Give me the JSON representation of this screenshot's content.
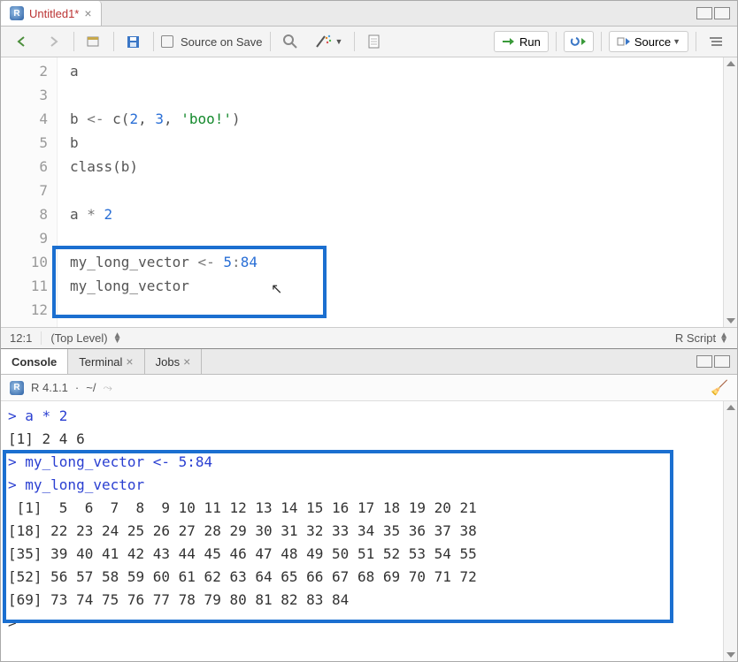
{
  "source": {
    "tab_title": "Untitled1*",
    "toolbar": {
      "source_on_save": "Source on Save",
      "run": "Run",
      "source_btn": "Source"
    },
    "gutter": [
      "2",
      "3",
      "4",
      "5",
      "6",
      "7",
      "8",
      "9",
      "10",
      "11",
      "12"
    ],
    "lines": {
      "l2": "a",
      "l3": "",
      "l4_pre": "b ",
      "l4_assign": "<-",
      "l4_c": " c(",
      "l4_n1": "2",
      "l4_c1": ", ",
      "l4_n2": "3",
      "l4_c2": ", ",
      "l4_str": "'boo!'",
      "l4_end": ")",
      "l5": "b",
      "l6": "class(b)",
      "l7": "",
      "l8_a": "a ",
      "l8_op": "*",
      "l8_sp": " ",
      "l8_n": "2",
      "l9": "",
      "l10_a": "my_long_vector ",
      "l10_assign": "<-",
      "l10_sp": " ",
      "l10_n1": "5",
      "l10_colon": ":",
      "l10_n2": "84",
      "l11": "my_long_vector",
      "l12": ""
    },
    "status": {
      "pos": "12:1",
      "scope": "(Top Level)",
      "lang": "R Script"
    }
  },
  "console": {
    "tabs": {
      "console": "Console",
      "terminal": "Terminal",
      "jobs": "Jobs"
    },
    "info": {
      "version": "R 4.1.1",
      "dot": "·",
      "path": "~/"
    },
    "lines": [
      {
        "cls": "cmd",
        "text": "> a * 2"
      },
      {
        "cls": "",
        "text": "[1] 2 4 6"
      },
      {
        "cls": "cmd",
        "text": "> my_long_vector <- 5:84"
      },
      {
        "cls": "cmd",
        "text": "> my_long_vector"
      },
      {
        "cls": "",
        "text": " [1]  5  6  7  8  9 10 11 12 13 14 15 16 17 18 19 20 21"
      },
      {
        "cls": "",
        "text": "[18] 22 23 24 25 26 27 28 29 30 31 32 33 34 35 36 37 38"
      },
      {
        "cls": "",
        "text": "[35] 39 40 41 42 43 44 45 46 47 48 49 50 51 52 53 54 55"
      },
      {
        "cls": "",
        "text": "[52] 56 57 58 59 60 61 62 63 64 65 66 67 68 69 70 71 72"
      },
      {
        "cls": "",
        "text": "[69] 73 74 75 76 77 78 79 80 81 82 83 84"
      },
      {
        "cls": "",
        "text": "> "
      }
    ]
  }
}
